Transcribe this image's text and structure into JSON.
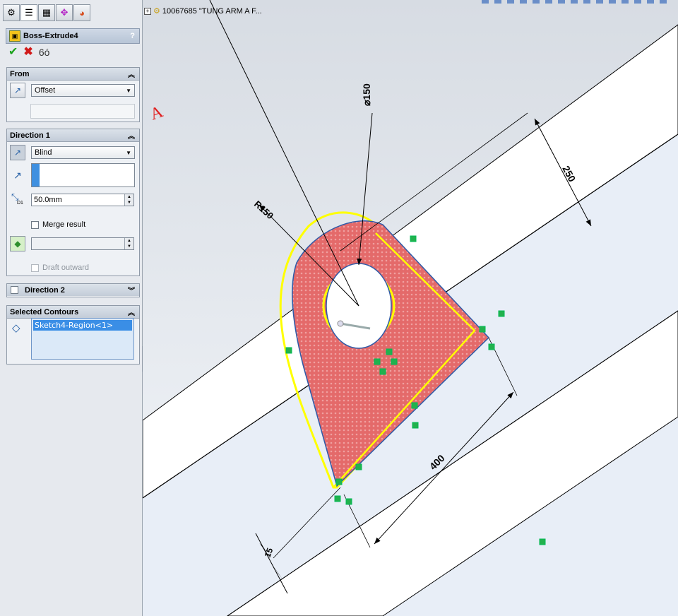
{
  "panel": {
    "tabs": [
      "feature-manager-icon",
      "property-manager-icon",
      "configuration-manager-icon",
      "dimxpert-icon",
      "display-manager-icon"
    ],
    "feature_title": "Boss-Extrude4",
    "help": "?",
    "from": {
      "header": "From",
      "value": "Offset"
    },
    "direction1": {
      "header": "Direction 1",
      "end_condition": "Blind",
      "depth": "50.0mm",
      "depth_label": "D1",
      "merge_result": "Merge result",
      "draft_outward": "Draft outward"
    },
    "direction2": {
      "header": "Direction 2"
    },
    "contours": {
      "header": "Selected Contours",
      "items": [
        "Sketch4-Region<1>"
      ]
    }
  },
  "tree": {
    "label": "10067685 \"TUNG ARM A F..."
  },
  "dims": {
    "dia": "⌀150",
    "d250": "250",
    "r150": "R150",
    "d400": "400",
    "d15": "15",
    "annot": "A"
  },
  "colors": {
    "profile_fill": "#e46a6a",
    "selection": "#ffff00",
    "sketch_green": "#23b14d",
    "band": "#ffffff"
  }
}
